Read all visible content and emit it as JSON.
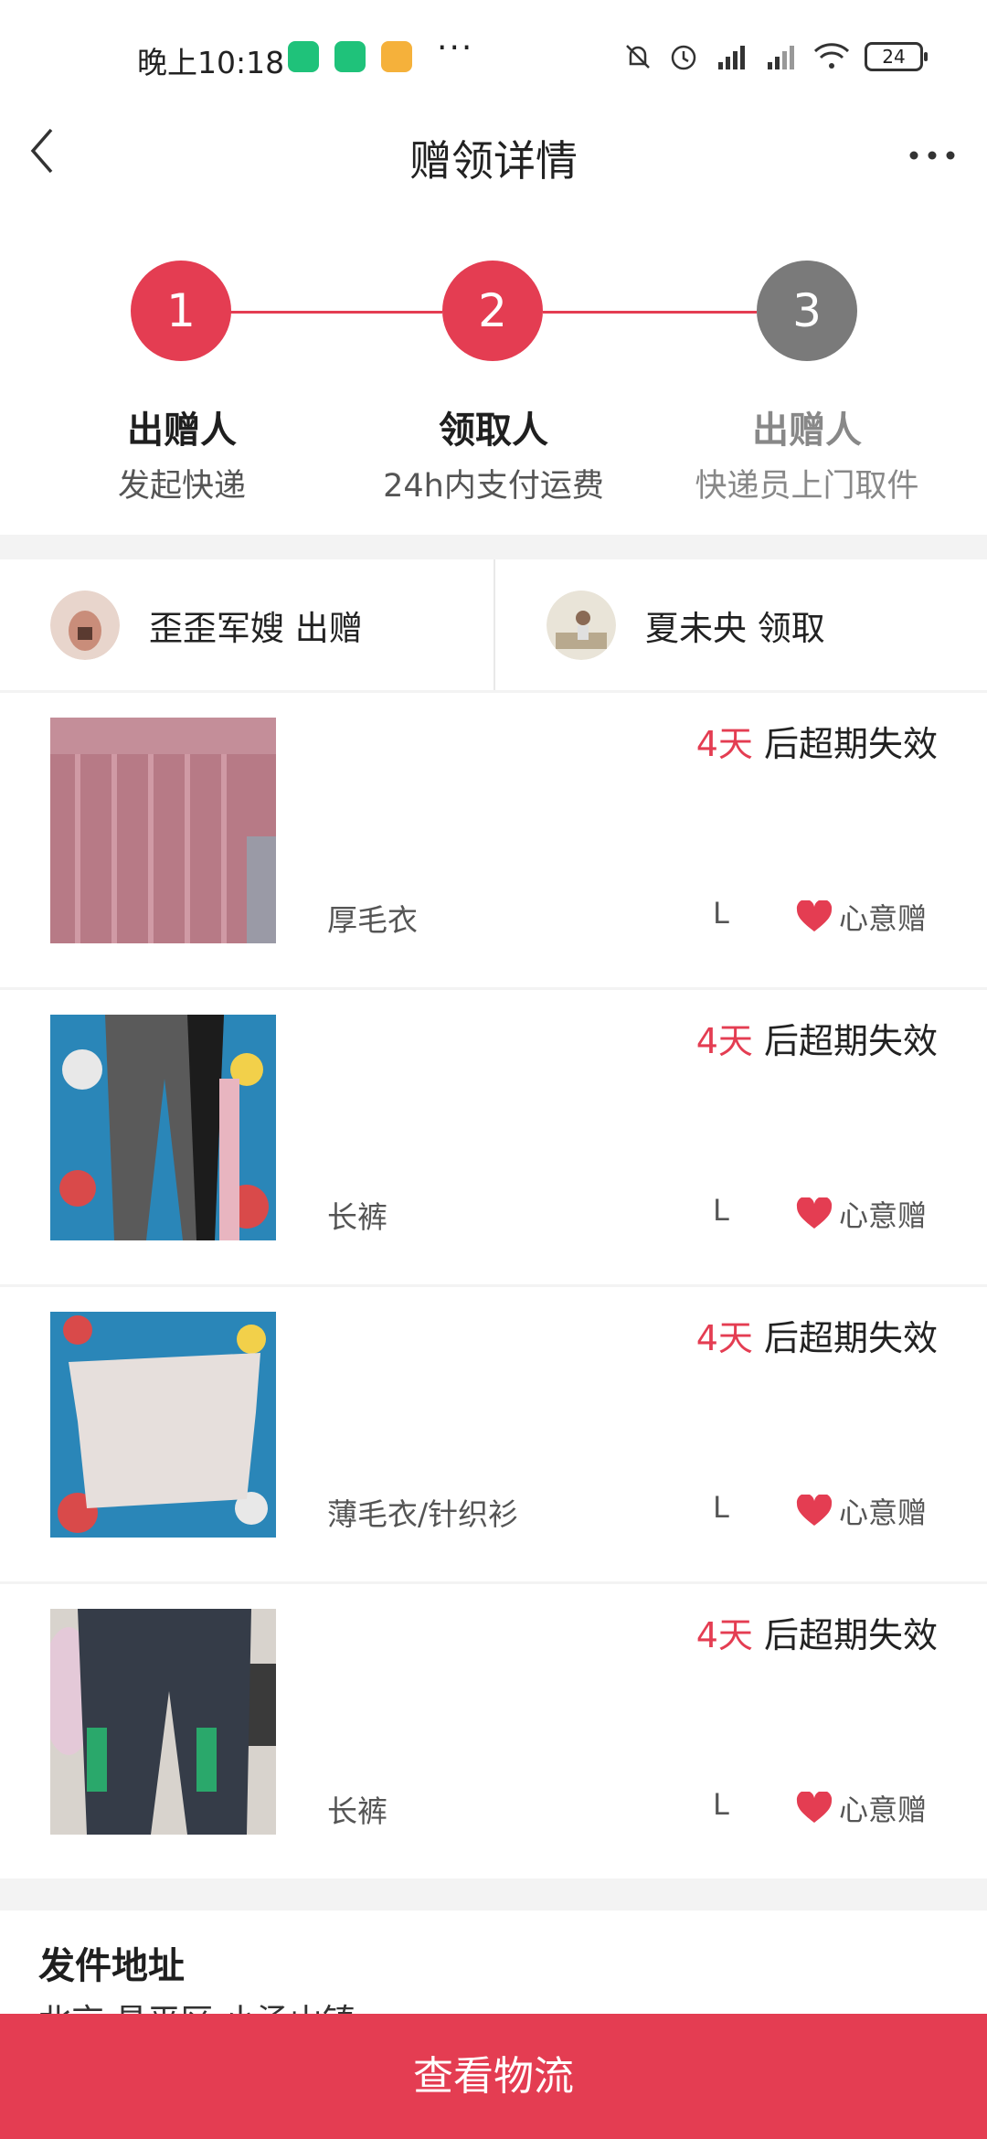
{
  "status_bar": {
    "time": "晚上10:18",
    "battery": "24",
    "icons": [
      "security-app-icon",
      "security-app-icon-2",
      "message-app-icon",
      "more-dots",
      "mute-icon",
      "alarm-icon",
      "signal-hd-icon",
      "signal-hd-icon-2",
      "wifi-icon",
      "battery-icon"
    ]
  },
  "nav": {
    "title": "赠领详情"
  },
  "steps": [
    {
      "number": "1",
      "title": "出赠人",
      "subtitle": "发起快递",
      "status": "active"
    },
    {
      "number": "2",
      "title": "领取人",
      "subtitle": "24h内支付运费",
      "status": "active"
    },
    {
      "number": "3",
      "title": "出赠人",
      "subtitle": "快递员上门取件",
      "status": "pending"
    }
  ],
  "users": {
    "giver": "歪歪军嫂 出赠",
    "receiver": "夏未央 领取"
  },
  "items": [
    {
      "days": "4天",
      "expiry_suffix": " 后超期失效",
      "name": "厚毛衣",
      "size": "L",
      "tag": "心意赠"
    },
    {
      "days": "4天",
      "expiry_suffix": " 后超期失效",
      "name": "长裤",
      "size": "L",
      "tag": "心意赠"
    },
    {
      "days": "4天",
      "expiry_suffix": " 后超期失效",
      "name": "薄毛衣/针织衫",
      "size": "L",
      "tag": "心意赠"
    },
    {
      "days": "4天",
      "expiry_suffix": " 后超期失效",
      "name": "长裤",
      "size": "L",
      "tag": "心意赠"
    }
  ],
  "address": {
    "title": "发件地址",
    "text": "北京 昌平区 小汤山镇 ..."
  },
  "bottom_button": "查看物流",
  "colors": {
    "accent": "#e43d52",
    "pending": "#7a7a7a"
  }
}
